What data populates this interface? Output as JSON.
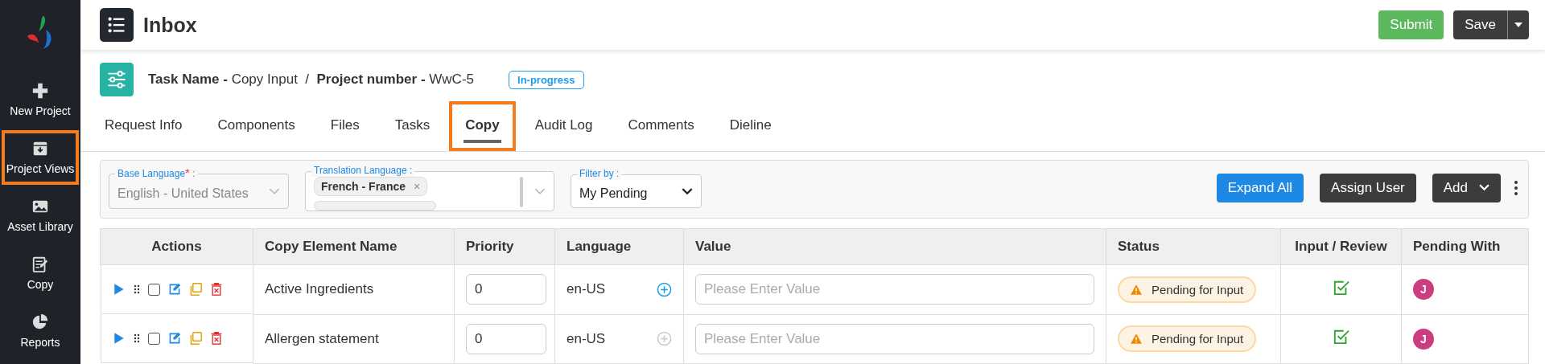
{
  "sidebar": {
    "items": [
      {
        "label": "New Project",
        "highlighted": false
      },
      {
        "label": "Project Views",
        "highlighted": true
      },
      {
        "label": "Asset Library",
        "highlighted": false
      },
      {
        "label": "Copy",
        "highlighted": false
      },
      {
        "label": "Reports",
        "highlighted": false
      }
    ]
  },
  "header": {
    "title": "Inbox",
    "buttons": [
      {
        "label": "Submit",
        "kind": "primary"
      },
      {
        "label": "Save",
        "kind": "split"
      }
    ]
  },
  "task": {
    "text": "**Task Name -** Copy Input  /  **Project number -** WwC-5",
    "status": "In-progress"
  },
  "tabs": [
    {
      "label": "Request Info",
      "selected": false,
      "highlighted": false
    },
    {
      "label": "Components",
      "selected": false,
      "highlighted": false
    },
    {
      "label": "Files",
      "selected": false,
      "highlighted": false
    },
    {
      "label": "Tasks",
      "selected": false,
      "highlighted": false
    },
    {
      "label": "Copy",
      "selected": true,
      "highlighted": true
    },
    {
      "label": "Audit Log",
      "selected": false,
      "highlighted": false
    },
    {
      "label": "Comments",
      "selected": false,
      "highlighted": false
    },
    {
      "label": "Dieline",
      "selected": false,
      "highlighted": false
    }
  ],
  "filters": {
    "base_language": {
      "label": "Base Language",
      "required_mark": "*",
      "label_end": ":",
      "value": "English - United States",
      "disabled": true
    },
    "translation_language": {
      "label": "Translation Language :",
      "tags": [
        {
          "label": "French - France",
          "remove": "×"
        }
      ]
    },
    "filter_by": {
      "label": "Filter by :",
      "value": "My Pending"
    },
    "buttons": [
      {
        "label": "Expand All",
        "kind": "primary"
      },
      {
        "label": "Assign User",
        "kind": "dark"
      },
      {
        "label": "Add",
        "kind": "dropdown"
      }
    ]
  },
  "table": {
    "columns": [
      "Actions",
      "Copy Element Name",
      "Priority",
      "Language",
      "Value",
      "Status",
      "Input / Review",
      "Pending With"
    ],
    "rows": [
      {
        "checked": false,
        "name": "Active Ingredients",
        "priority": "0",
        "language": "en-US",
        "add_enabled": true,
        "placeholder": "Please Enter Value",
        "status": "Pending for Input",
        "reviewed": true,
        "avatar": "J",
        "color": "#cc3d7f"
      },
      {
        "checked": false,
        "name": "Allergen statement",
        "priority": "0",
        "language": "en-US",
        "add_enabled": false,
        "placeholder": "Please Enter Value",
        "status": "Pending for Input",
        "reviewed": true,
        "avatar": "J",
        "color": "#cc3d7f"
      }
    ]
  }
}
